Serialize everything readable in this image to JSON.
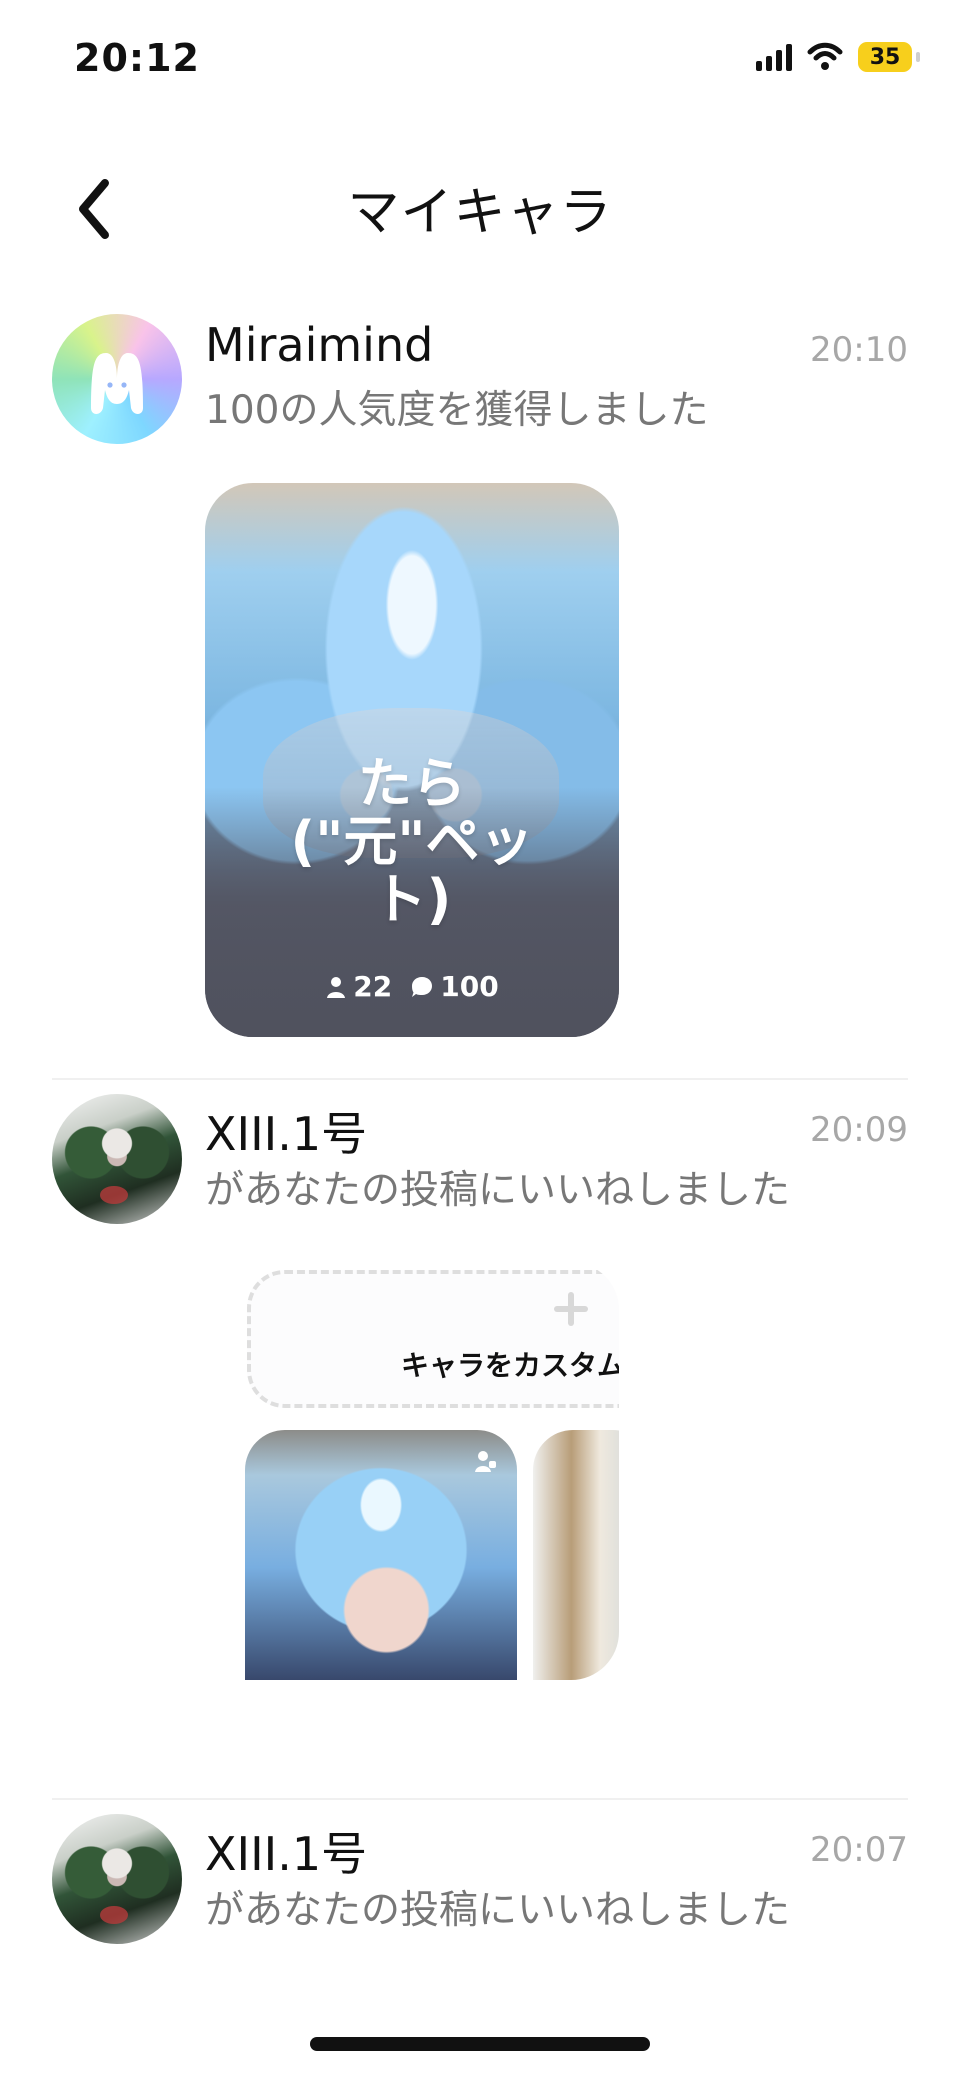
{
  "status_bar": {
    "time": "20:12",
    "battery": "35",
    "icons": [
      "signal-icon",
      "wifi-icon",
      "battery-icon"
    ]
  },
  "navigation": {
    "title": "マイキャラ",
    "back_icon": "chevron-left-icon"
  },
  "notifications": [
    {
      "sender": "Miraimind",
      "time": "20:10",
      "message": "100の人気度を獲得しました",
      "card": {
        "title": "たら\n(\"元\"ペッ\nト)",
        "followers": "22",
        "comments": "100"
      }
    },
    {
      "sender": "XIII.1号",
      "time": "20:09",
      "message": "があなたの投稿にいいねしました",
      "preview": {
        "custom_label": "キャラをカスタムす"
      }
    },
    {
      "sender": "XIII.1号",
      "time": "20:07",
      "message": "があなたの投稿にいいねしました"
    }
  ],
  "colors": {
    "time_gray": "#A7A7A7",
    "message_gray": "#777777",
    "battery_yellow": "#F7CF1C"
  }
}
